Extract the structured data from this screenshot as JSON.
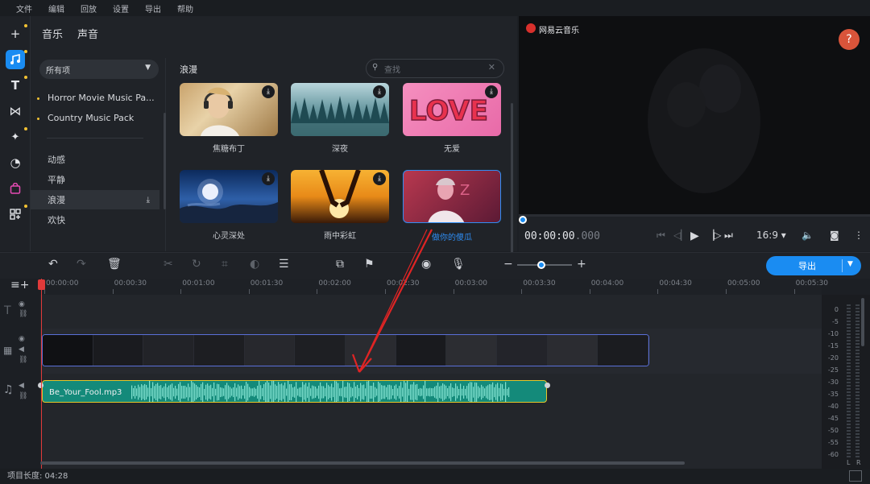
{
  "menu": [
    "文件",
    "编辑",
    "回放",
    "设置",
    "导出",
    "帮助"
  ],
  "tabs": [
    "音乐",
    "声音"
  ],
  "category_dropdown": "所有项",
  "packs": [
    "Horror Movie Music Pa...",
    "Country Music Pack"
  ],
  "categories": [
    {
      "label": "动感",
      "selected": false
    },
    {
      "label": "平静",
      "selected": false
    },
    {
      "label": "浪漫",
      "selected": true
    },
    {
      "label": "欢快",
      "selected": false
    }
  ],
  "grid_title": "浪漫",
  "search_placeholder": "查找",
  "cards": [
    {
      "caption": "焦糖布丁"
    },
    {
      "caption": "深夜"
    },
    {
      "caption": "无爱"
    },
    {
      "caption": "心灵深处"
    },
    {
      "caption": "雨中彩虹"
    },
    {
      "caption": "做你的傻瓜",
      "selected": true
    }
  ],
  "love_text": "LOVE",
  "preview": {
    "watermark": "网易云音乐",
    "help": "?"
  },
  "timecode": {
    "main": "00:00:00",
    "ms": ".000"
  },
  "aspect": "16:9",
  "export_label": "导出",
  "ruler_ticks": [
    "00:00:00",
    "00:00:30",
    "00:01:00",
    "00:01:30",
    "00:02:00",
    "00:02:30",
    "00:03:00",
    "00:03:30",
    "00:04:00",
    "00:04:30",
    "00:05:00",
    "00:05:30"
  ],
  "audio_clip_name": "Be_Your_Fool.mp3",
  "meter_ticks": [
    "0",
    "-5",
    "-10",
    "-15",
    "-20",
    "-25",
    "-30",
    "-35",
    "-40",
    "-45",
    "-50",
    "-55",
    "-60"
  ],
  "meter_lr": [
    "L",
    "R"
  ],
  "status": "项目长度: 04:28",
  "colors": {
    "accent": "#1a8cf2",
    "audio": "#148a7a",
    "audio_border": "#e6c729",
    "video_border": "#5a6fd8",
    "playhead": "#e03a3a",
    "arrow": "#e02424"
  }
}
